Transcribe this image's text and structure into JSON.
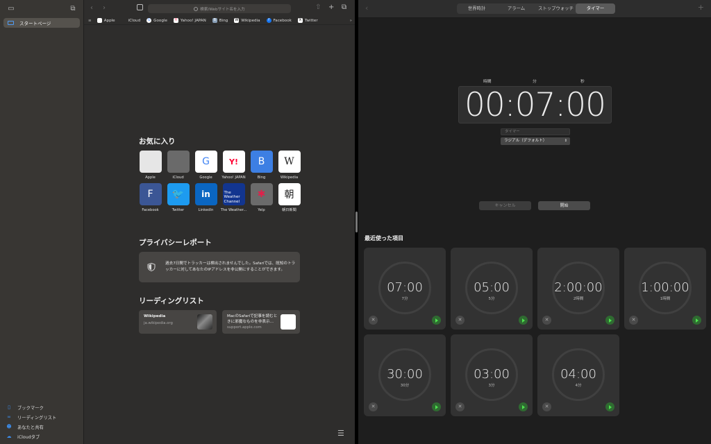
{
  "safari": {
    "sidebar": {
      "start_page": "スタートページ",
      "bottom_items": [
        "ブックマーク",
        "リーディングリスト",
        "あなたと共有",
        "iCloudタブ"
      ]
    },
    "address_placeholder": "検索/Webサイト名を入力",
    "bookmarks": [
      {
        "label": "Apple",
        "icon": "apple-icon"
      },
      {
        "label": "iCloud",
        "icon": "apple-icon"
      },
      {
        "label": "Google",
        "icon": "google-icon"
      },
      {
        "label": "Yahoo! JAPAN",
        "icon": "yahoo-icon"
      },
      {
        "label": "Bing",
        "icon": "bing-icon"
      },
      {
        "label": "Wikipedia",
        "icon": "wikipedia-icon"
      },
      {
        "label": "Facebook",
        "icon": "facebook-icon"
      },
      {
        "label": "Twitter",
        "icon": "x-icon"
      }
    ],
    "favorites_title": "お気に入り",
    "favorites": [
      {
        "label": "Apple",
        "glyph": "",
        "color": "#e6e6e6"
      },
      {
        "label": "iCloud",
        "glyph": "",
        "color": "#6a6a6a"
      },
      {
        "label": "Google",
        "glyph": "G",
        "color": "#ffffff"
      },
      {
        "label": "Yahoo! JAPAN",
        "glyph": "Y!",
        "color": "#ffffff"
      },
      {
        "label": "Bing",
        "glyph": "B",
        "color": "#3d7fe3"
      },
      {
        "label": "Wikipedia",
        "glyph": "W",
        "color": "#ffffff"
      },
      {
        "label": "Facebook",
        "glyph": "F",
        "color": "#3b5695"
      },
      {
        "label": "Twitter",
        "glyph": "🐦",
        "color": "#1d9bf0"
      },
      {
        "label": "LinkedIn",
        "glyph": "in",
        "color": "#0a66c2"
      },
      {
        "label": "The Weather...",
        "glyph": "The Weather Channel",
        "color": "#12358f"
      },
      {
        "label": "Yelp",
        "glyph": "✱",
        "color": "#6b6b6b"
      },
      {
        "label": "朝日新聞",
        "glyph": "朝",
        "color": "#ffffff"
      }
    ],
    "privacy_title": "プライバシーレポート",
    "privacy_text": "過去7日間でトラッカーは検出されませんでした。Safariでは、既知のトラッカーに対してあなたのIPアドレスを非公開にすることができます。",
    "reading_title": "リーディングリスト",
    "reading_items": [
      {
        "title": "Wikipedia",
        "subtitle": "ja.wikipedia.org"
      },
      {
        "title": "MacのSafariで記事を読むときに邪魔なものを非表示…",
        "subtitle": "support.apple.com"
      }
    ]
  },
  "clock": {
    "tabs": [
      "世界時計",
      "アラーム",
      "ストップウォッチ",
      "タイマー"
    ],
    "active_tab": "タイマー",
    "units": {
      "hours": "時間",
      "minutes": "分",
      "seconds": "秒"
    },
    "time_display": "00:07:00",
    "label_placeholder": "タイマー",
    "sound": "ラジアル（デフォルト）",
    "cancel_label": "キャンセル",
    "start_label": "開始",
    "recent_title": "最近使った項目",
    "recents": [
      {
        "time": "07:00",
        "label": "7分"
      },
      {
        "time": "05:00",
        "label": "5分"
      },
      {
        "time": "2:00:00",
        "label": "2時間"
      },
      {
        "time": "1:00:00",
        "label": "1時間"
      },
      {
        "time": "30:00",
        "label": "30分"
      },
      {
        "time": "03:00",
        "label": "3分"
      },
      {
        "time": "04:00",
        "label": "4分"
      }
    ]
  }
}
